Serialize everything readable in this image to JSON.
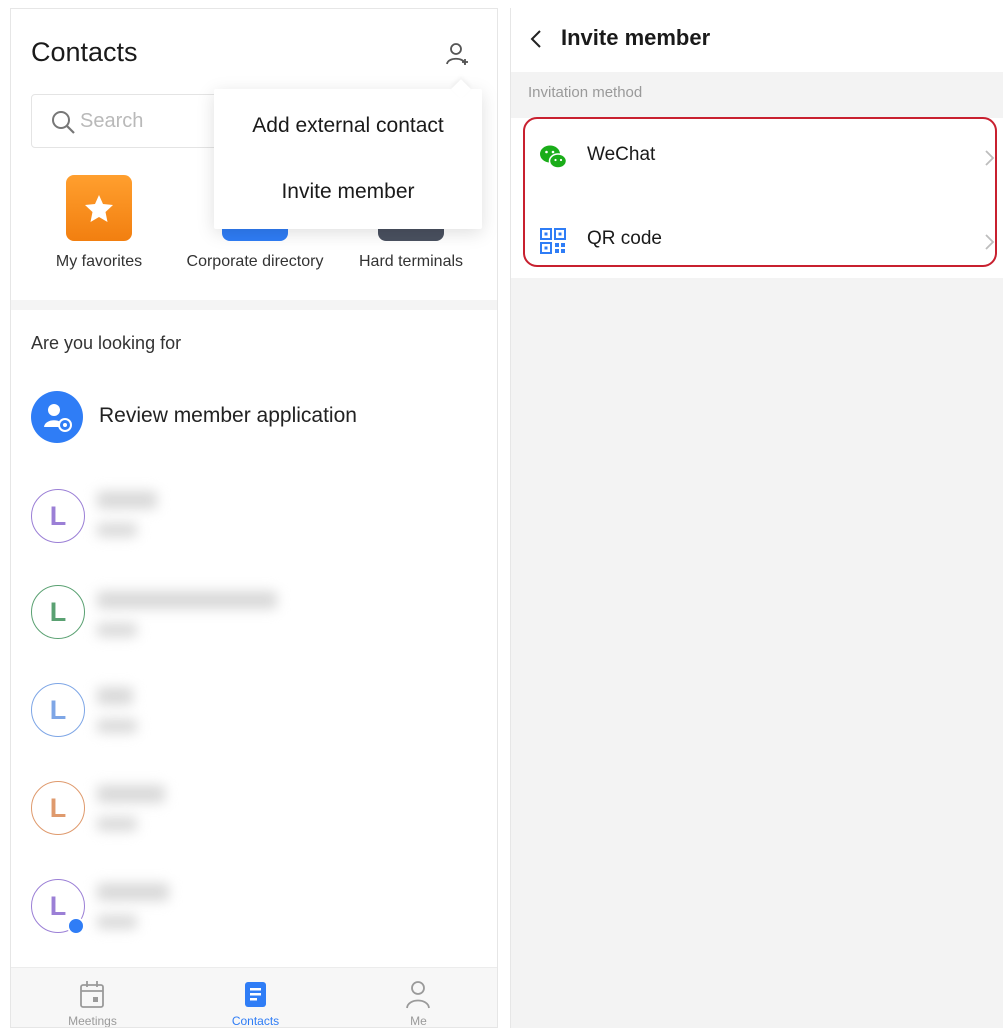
{
  "contacts_screen": {
    "title": "Contacts",
    "search": {
      "placeholder": "Search"
    },
    "popup_menu": {
      "items": [
        "Add external contact",
        "Invite member"
      ]
    },
    "quick_access": [
      {
        "label": "My favorites",
        "icon": "star-icon",
        "color": "#f78b1c"
      },
      {
        "label": "Corporate directory",
        "icon": "directory-icon",
        "color": "#2f7df6"
      },
      {
        "label": "Hard terminals",
        "icon": "terminal-icon",
        "color": "#4a5160"
      }
    ],
    "looking_for_label": "Are you looking for",
    "review_item": {
      "label": "Review member application",
      "icon": "member-review-icon"
    },
    "contacts": [
      {
        "initial": "L",
        "color": "#9b7fd6"
      },
      {
        "initial": "L",
        "color": "#5aa172"
      },
      {
        "initial": "L",
        "color": "#7ea6e6"
      },
      {
        "initial": "L",
        "color": "#df9a6d"
      },
      {
        "initial": "L",
        "color": "#9b7fd6"
      }
    ],
    "tabbar": {
      "tabs": [
        {
          "label": "Meetings",
          "icon": "calendar-icon",
          "active": false
        },
        {
          "label": "Contacts",
          "icon": "contacts-book-icon",
          "active": true
        },
        {
          "label": "Me",
          "icon": "person-icon",
          "active": false
        }
      ]
    }
  },
  "invite_screen": {
    "title": "Invite member",
    "section_label": "Invitation method",
    "methods": [
      {
        "label": "WeChat",
        "icon": "wechat-icon",
        "color": "#1aad19"
      },
      {
        "label": "QR code",
        "icon": "qr-code-icon",
        "color": "#2f7df6"
      }
    ],
    "highlight_color": "#c8202f"
  },
  "colors": {
    "accent": "#2f7df6",
    "favorites_orange": "#f78b1c"
  }
}
